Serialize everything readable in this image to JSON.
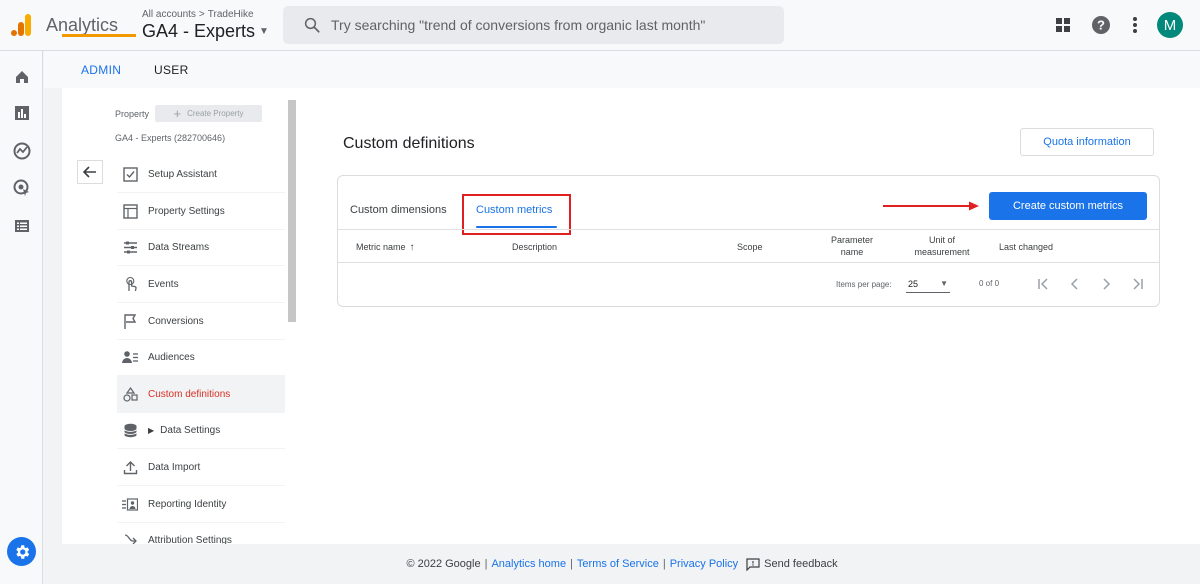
{
  "header": {
    "app_title": "Analytics",
    "breadcrumb": {
      "account": "All accounts",
      "separator": ">",
      "child": "TradeHike"
    },
    "property_name": "GA4 - Experts",
    "search_placeholder": "Try searching \"trend of conversions from organic last month\"",
    "avatar_letter": "M",
    "icons": [
      "apps-grid-icon",
      "help-icon",
      "more-vert-icon"
    ]
  },
  "rail": {
    "icons": [
      "home-icon",
      "reports-icon",
      "explore-icon",
      "advertising-icon",
      "configure-icon",
      "settings-icon"
    ]
  },
  "admin_tabs": [
    {
      "label": "ADMIN",
      "active": true
    },
    {
      "label": "USER",
      "active": false
    }
  ],
  "nav": {
    "property_label": "Property",
    "create_property": "Create Property",
    "property_id": "GA4 - Experts (282700646)",
    "items": [
      {
        "label": "Setup Assistant",
        "icon": "checkbox-icon"
      },
      {
        "label": "Property Settings",
        "icon": "property-settings-icon"
      },
      {
        "label": "Data Streams",
        "icon": "data-streams-icon"
      },
      {
        "label": "Events",
        "icon": "events-touch-icon"
      },
      {
        "label": "Conversions",
        "icon": "flag-icon"
      },
      {
        "label": "Audiences",
        "icon": "audiences-icon"
      },
      {
        "label": "Custom definitions",
        "icon": "shapes-icon",
        "active": true
      },
      {
        "label": "Data Settings",
        "icon": "database-icon",
        "expandable": true
      },
      {
        "label": "Data Import",
        "icon": "upload-icon"
      },
      {
        "label": "Reporting Identity",
        "icon": "reporting-identity-icon"
      },
      {
        "label": "Attribution Settings",
        "icon": "attribution-icon"
      }
    ]
  },
  "content": {
    "title": "Custom definitions",
    "quota_button": "Quota information",
    "tabs": [
      {
        "label": "Custom dimensions",
        "active": false
      },
      {
        "label": "Custom metrics",
        "active": true
      }
    ],
    "create_button": "Create custom metrics",
    "columns": [
      "Metric name",
      "Description",
      "Scope",
      "Parameter name",
      "Unit of measurement",
      "Last changed"
    ],
    "pager": {
      "items_per_page_label": "Items per page:",
      "items_per_page": "25",
      "count": "0 of 0"
    }
  },
  "footer": {
    "copyright": "© 2022 Google",
    "links": [
      "Analytics home",
      "Terms of Service",
      "Privacy Policy"
    ],
    "feedback": "Send feedback"
  },
  "colors": {
    "accent": "#1a73e8",
    "active_nav": "#d93025",
    "admin_underline": "#f29900",
    "annotation": "#e02020"
  }
}
